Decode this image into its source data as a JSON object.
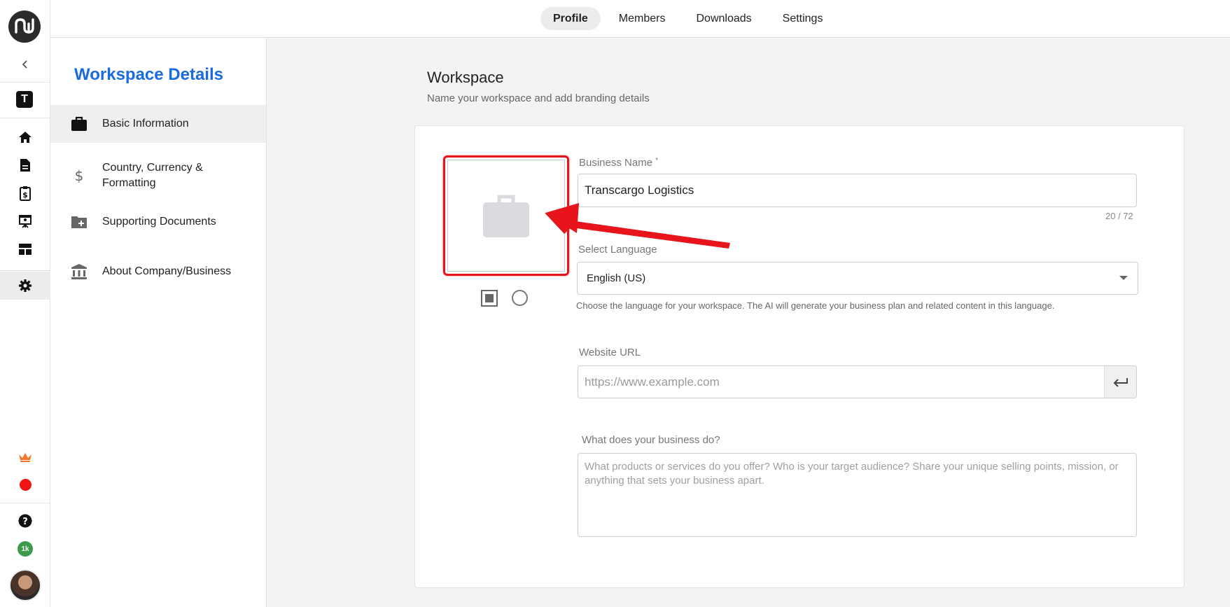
{
  "top_tabs": [
    "Profile",
    "Members",
    "Downloads",
    "Settings"
  ],
  "rail": {
    "workspace_initial": "T",
    "credits": "1k"
  },
  "sidebar": {
    "title": "Workspace Details",
    "items": [
      {
        "label": "Basic Information",
        "icon": "briefcase-icon"
      },
      {
        "label": "Country, Currency & Formatting",
        "icon": "dollar-icon"
      },
      {
        "label": "Supporting Documents",
        "icon": "folder-plus-icon"
      },
      {
        "label": "About Company/Business",
        "icon": "bank-icon"
      }
    ]
  },
  "main": {
    "heading": "Workspace",
    "subheading": "Name your workspace and add branding details"
  },
  "form": {
    "business_name_label": "Business Name",
    "business_name_required": "*",
    "business_name_value": "Transcargo Logistics",
    "business_name_count": "20 / 72",
    "language_label": "Select Language",
    "language_value": "English (US)",
    "language_help": "Choose the language for your workspace. The AI will generate your business plan and related content in this language.",
    "website_label": "Website URL",
    "website_placeholder": "https://www.example.com",
    "business_desc_label": "What does your business do?",
    "business_desc_placeholder": "What products or services do you offer? Who is your target audience? Share your unique selling points, mission, or anything that sets your business apart."
  },
  "colors": {
    "accent": "#1a6be0",
    "highlight": "#e8141c",
    "active_bg": "#ececec"
  }
}
